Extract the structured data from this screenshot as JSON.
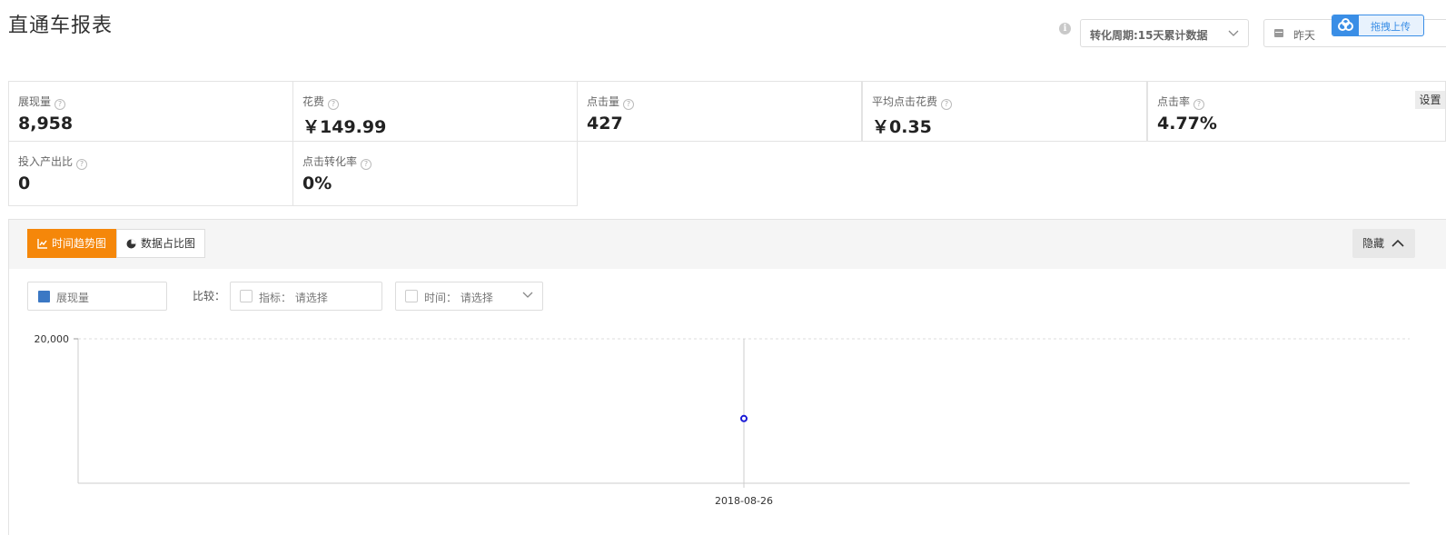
{
  "header": {
    "title": "直通车报表",
    "cycle_select": "转化周期:15天累计数据",
    "date_value": "昨天",
    "upload_label": "拖拽上传"
  },
  "metrics": [
    {
      "label": "展现量",
      "value": "8,958"
    },
    {
      "label": "花费",
      "value": "￥149.99"
    },
    {
      "label": "点击量",
      "value": "427"
    },
    {
      "label": "平均点击花费",
      "value": "￥0.35"
    },
    {
      "label": "点击率",
      "value": "4.77%"
    },
    {
      "label": "投入产出比",
      "value": "0"
    },
    {
      "label": "点击转化率",
      "value": "0%"
    }
  ],
  "settings_label": "设置",
  "panel": {
    "tabs": [
      {
        "label": "时间趋势图",
        "active": true
      },
      {
        "label": "数据占比图",
        "active": false
      }
    ],
    "hide_label": "隐藏",
    "legend_label": "展现量",
    "compare_label": "比较：",
    "metric_filter": "指标： 请选择",
    "time_filter": "时间： 请选择"
  },
  "chart_data": {
    "type": "line",
    "x": [
      "2018-08-26"
    ],
    "series": [
      {
        "name": "展现量",
        "values": [
          8958
        ]
      }
    ],
    "ylim": [
      0,
      20000
    ],
    "y_ticks": [
      "20,000"
    ],
    "grid": true,
    "colors": {
      "series": "#1a1ad6",
      "grid": "#dddddd",
      "axis": "#cccccc"
    }
  },
  "colors": {
    "accent": "#f5870a",
    "brand_blue": "#3a8ee6",
    "legend_swatch": "#3b78c4"
  }
}
